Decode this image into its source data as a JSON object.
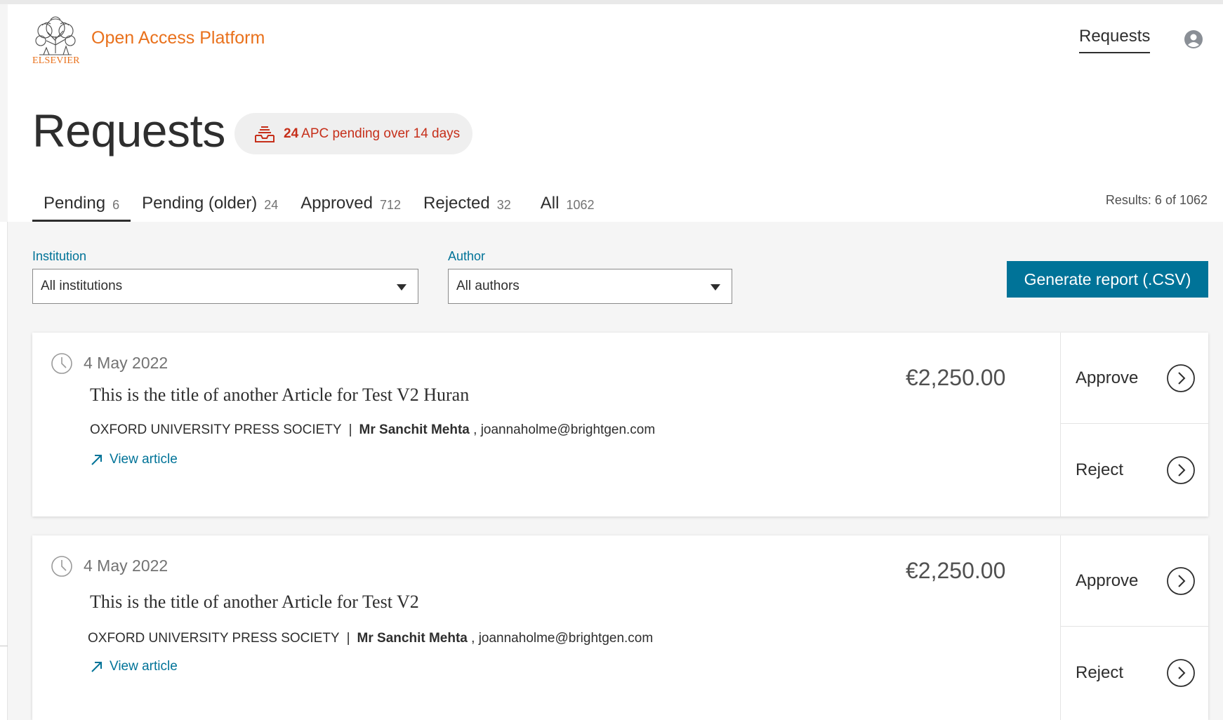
{
  "header": {
    "logo_text": "ELSEVIER",
    "platform_title": "Open Access Platform",
    "nav_requests": "Requests",
    "brand_color": "#e9711c"
  },
  "page": {
    "title": "Requests",
    "pending_count": "24",
    "pending_message": "APC pending over 14 days",
    "results": "Results: 6 of 1062"
  },
  "tabs": [
    {
      "label": "Pending",
      "count": "6"
    },
    {
      "label": "Pending (older)",
      "count": "24"
    },
    {
      "label": "Approved",
      "count": "712"
    },
    {
      "label": "Rejected",
      "count": "32"
    },
    {
      "label": "All",
      "count": "1062"
    }
  ],
  "filters": {
    "institution_label": "Institution",
    "institution_value": "All institutions",
    "author_label": "Author",
    "author_value": "All authors",
    "report_button": "Generate report (.CSV)"
  },
  "requests": [
    {
      "date": "4 May 2022",
      "title": "This is the title of another Article for Test V2 Huran",
      "publisher": "OXFORD UNIVERSITY PRESS SOCIETY",
      "separator": "|",
      "author": "Mr Sanchit Mehta",
      "email": ", joannaholme@brightgen.com",
      "link": "View article",
      "price": "€2,250.00",
      "approve": "Approve",
      "reject": "Reject"
    },
    {
      "date": "4 May 2022",
      "title": "This is the title of another Article for Test V2",
      "publisher": "OXFORD UNIVERSITY PRESS SOCIETY",
      "separator": "|",
      "author": "Mr Sanchit Mehta",
      "email": ", joannaholme@brightgen.com",
      "link": "View article",
      "price": "€2,250.00",
      "approve": "Approve",
      "reject": "Reject"
    }
  ],
  "colors": {
    "accent": "#007398",
    "alert": "#c62f1a"
  }
}
